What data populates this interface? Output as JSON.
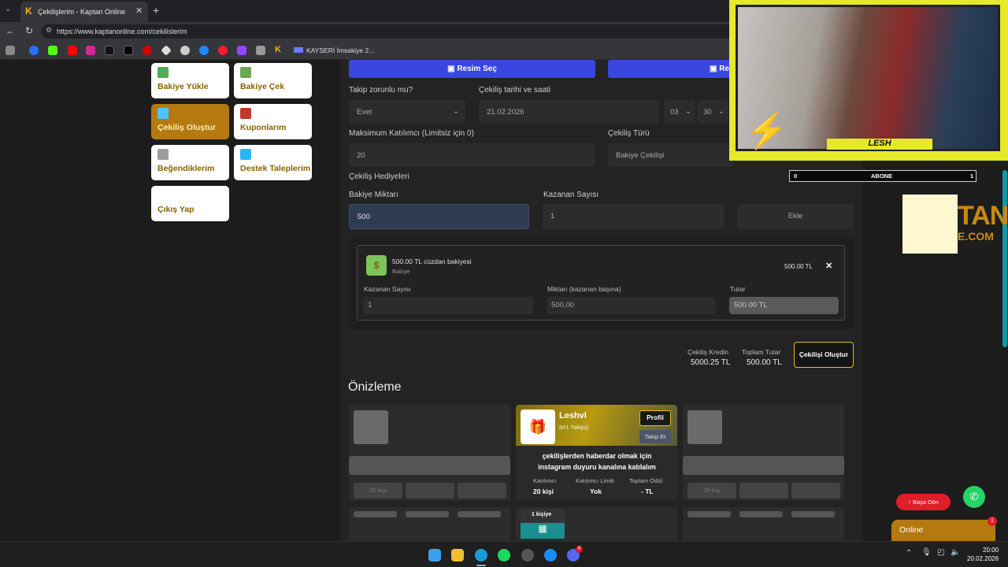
{
  "browser": {
    "tab_title": "Çekilişlerim - Kaptan Online",
    "url": "https://www.kaptanonline.com/cekilislerim",
    "bookmark_label": "KAYSERİ İmsakiye 2..."
  },
  "sidebar_menu": [
    {
      "label": "Bakiye Yükle",
      "active": false
    },
    {
      "label": "Bakiye Çek",
      "active": false
    },
    {
      "label": "Çekiliş Oluştur",
      "active": true
    },
    {
      "label": "Kuponlarım",
      "active": false
    },
    {
      "label": "Beğendiklerim",
      "active": false
    },
    {
      "label": "Destek Taleplerim",
      "active": false
    },
    {
      "label": "Çıkış Yap",
      "active": false
    }
  ],
  "form": {
    "image_button": "Resim Seç",
    "follow_label": "Takip zorunlu mu?",
    "follow_value": "Evet",
    "date_label": "Çekiliş tarihi ve saati",
    "date_value": "21.02.2026",
    "hour_value": "03",
    "minute_value": "30",
    "max_label": "Maksimum Katılımcı (Limitsiz için 0)",
    "max_value": "20",
    "type_label": "Çekiliş Türü",
    "type_value": "Bakiye Çekilişi",
    "gifts_label": "Çekiliş Hediyeleri",
    "amount_label": "Bakiye Miktarı",
    "amount_value": "500",
    "winners_label": "Kazanan Sayısı",
    "winners_value": "1",
    "add_button": "Ekle"
  },
  "gift_item": {
    "title": "500.00 TL cüzdan bakiyesi",
    "subtitle": "Bakiye",
    "total": "500.00 TL",
    "winners_label": "Kazanan Sayısı",
    "winners_value": "1",
    "per_label": "Miktarı (kazanan başına)",
    "per_value": "500,00",
    "sum_label": "Tutar",
    "sum_value": "500.00 TL"
  },
  "summary": {
    "credit_label": "Çekiliş Kredin",
    "credit_value": "5000.25 TL",
    "total_label": "Toplam Tutar",
    "total_value": "500.00 TL",
    "create_button": "Çekilişi Oluştur"
  },
  "preview": {
    "heading": "Önizleme",
    "name": "Leshvl",
    "followers": "841 Takipçi",
    "profile_button": "Profil",
    "follow_button": "Takip Et",
    "description": "çekilişlerden haberdar olmak için instagram duyuru kanalına katılalım",
    "stats": [
      {
        "label": "Katılımcı",
        "value": "20 kişi"
      },
      {
        "label": "Katılımcı Limiti",
        "value": "Yok"
      },
      {
        "label": "Toplam Ödül",
        "value": "- TL"
      }
    ],
    "ghost_left": "20 kişi",
    "ghost_right": "20 kişi",
    "gift_badge": "1 kişiye"
  },
  "floating": {
    "back_button": "Başa Dön",
    "online_label": "Online",
    "online_badge": "1"
  },
  "webcam": {
    "name": "LESH",
    "sub_min": "0",
    "sub_label": "ABONE",
    "sub_max": "1",
    "logo_text_1": "TAN",
    "logo_text_2": "E.COM"
  },
  "taskbar": {
    "time": "20:00",
    "date": "20.02.2026",
    "discord_badge": "9"
  },
  "colors": {
    "accent_gold": "#b47a10",
    "primary_blue": "#3a46e0",
    "whatsapp": "#25d366",
    "back_red": "#e11d2a"
  }
}
